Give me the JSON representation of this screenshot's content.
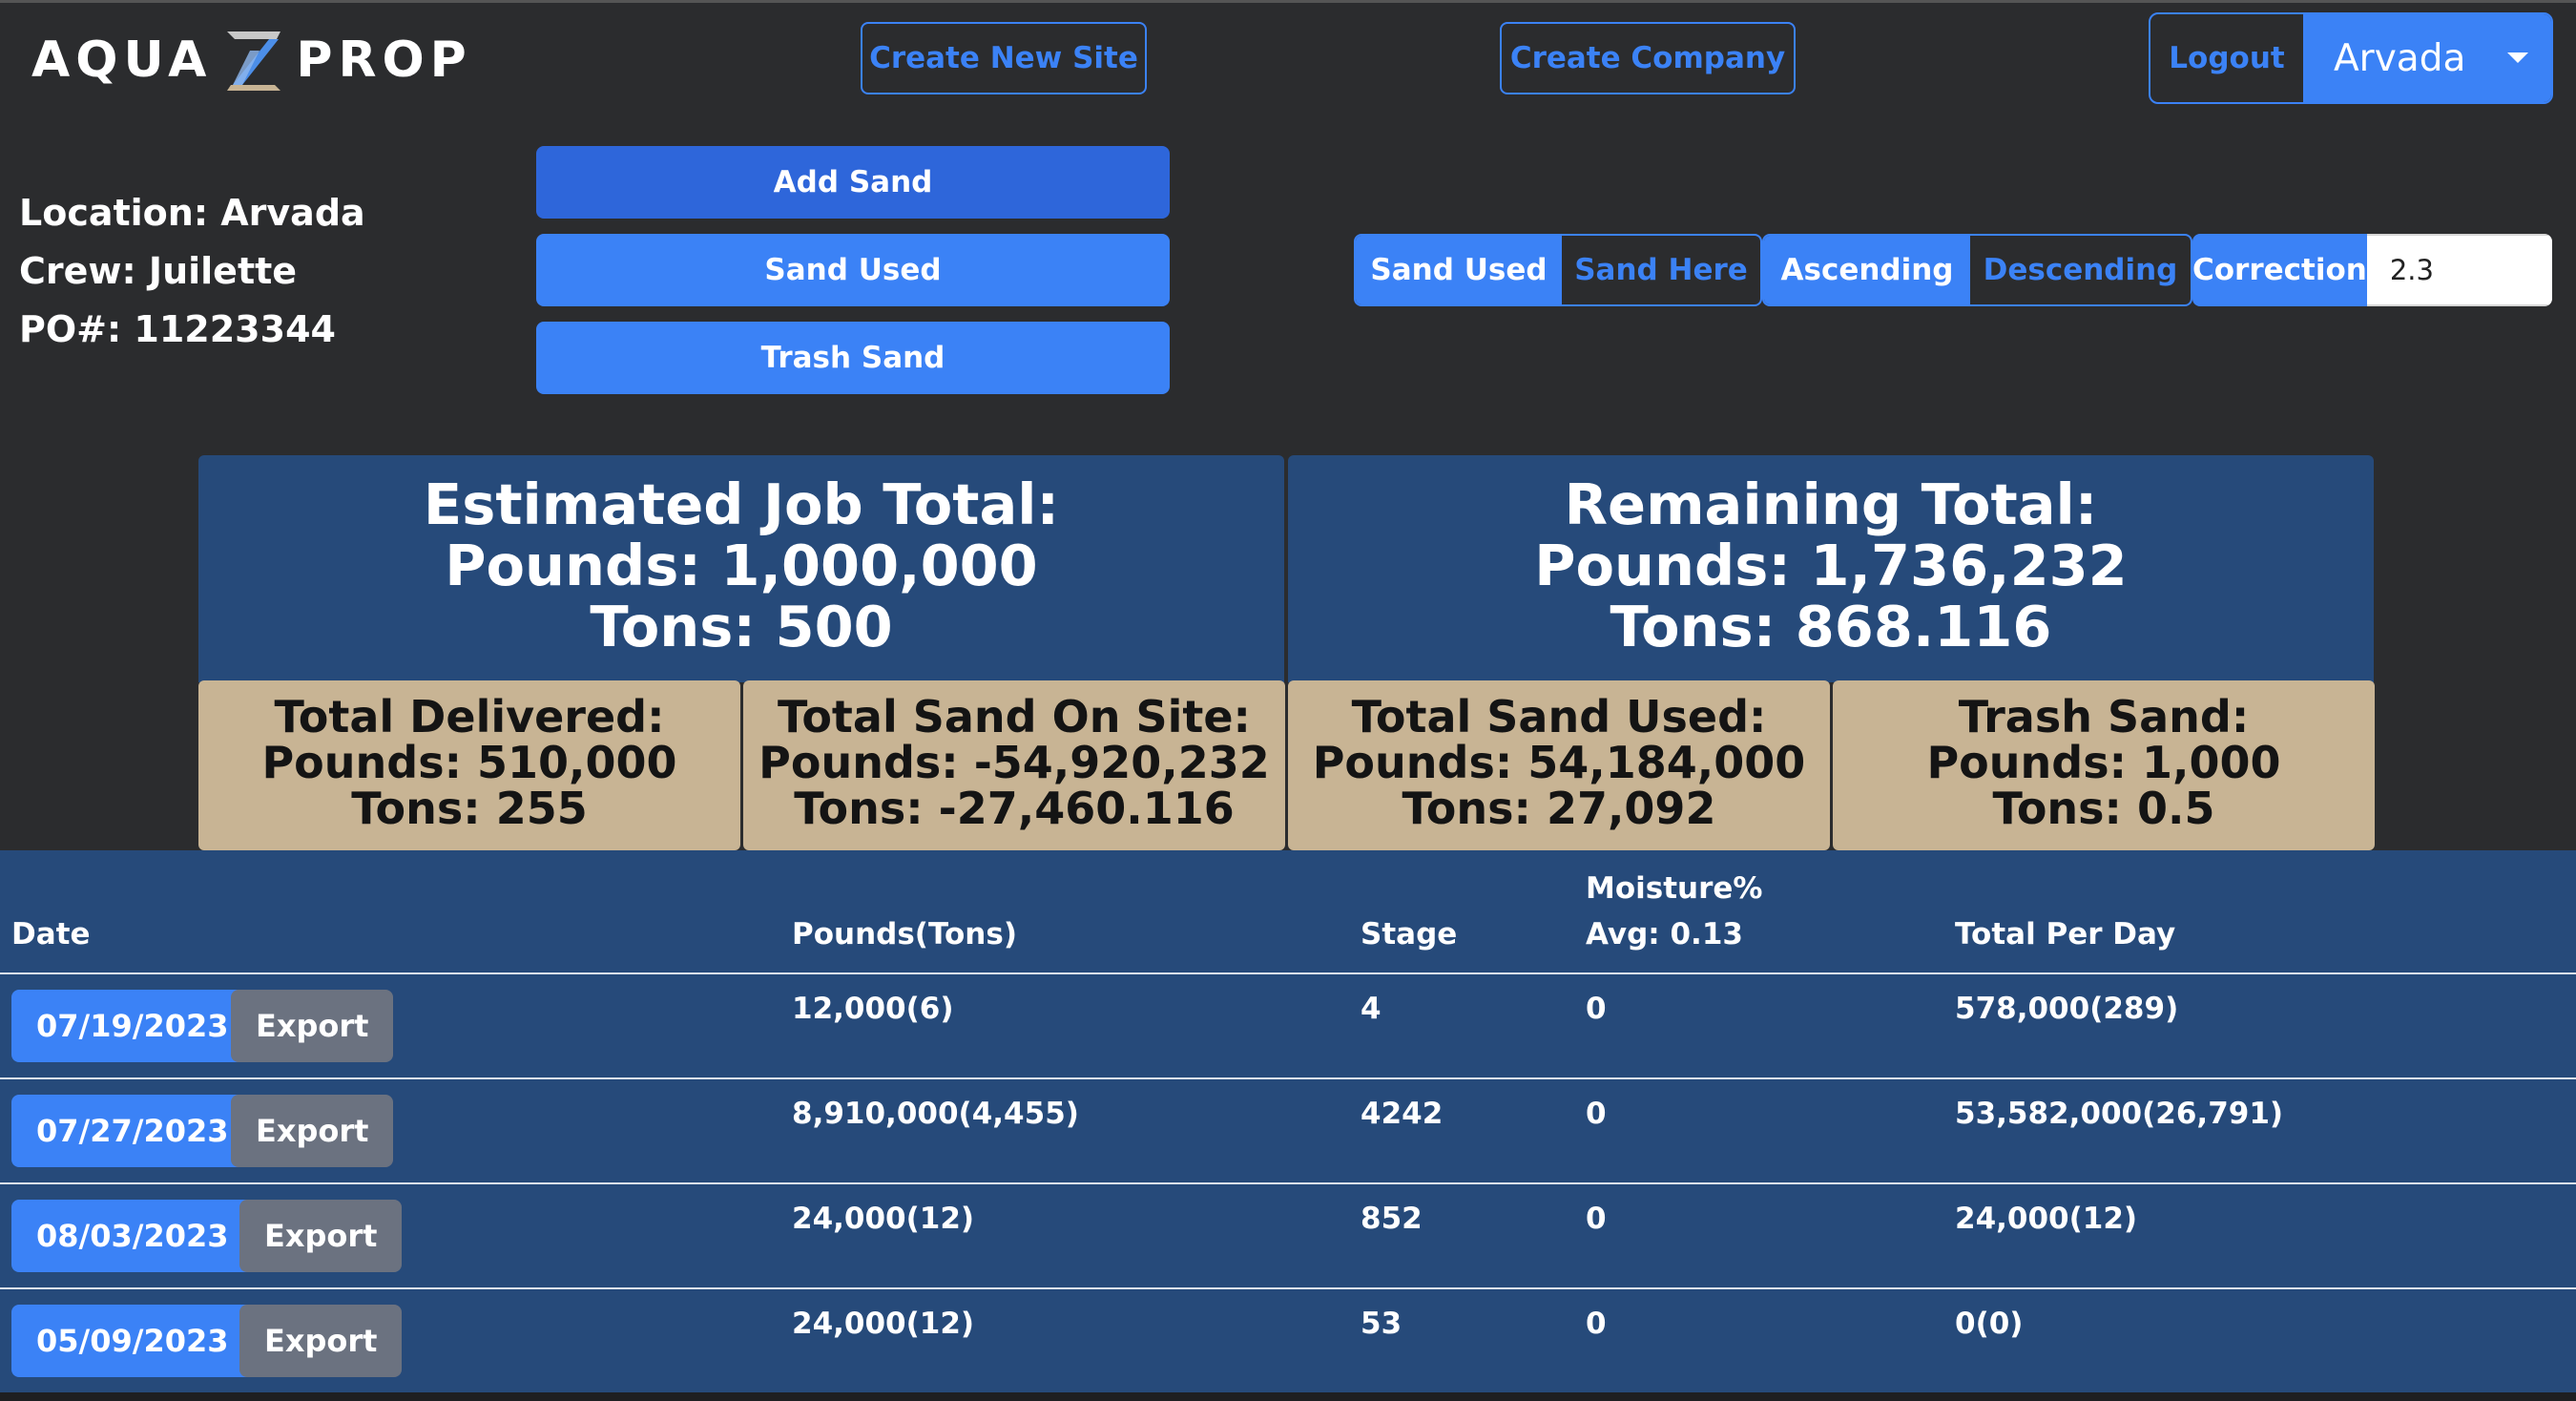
{
  "header": {
    "logo_left": "AQUA",
    "logo_right": "PROP",
    "create_site_label": "Create New Site",
    "create_company_label": "Create Company",
    "logout_label": "Logout",
    "selected_site": "Arvada"
  },
  "info": {
    "location": "Location: Arvada",
    "crew": "Crew: Juilette",
    "po": "PO#: 11223344"
  },
  "actions": {
    "add_sand": "Add Sand",
    "sand_used": "Sand Used",
    "trash_sand": "Trash Sand"
  },
  "toggles": {
    "sort_field": [
      "Sand Used",
      "Sand Here"
    ],
    "sort_order": [
      "Ascending",
      "Descending"
    ],
    "correction_label": "Correction",
    "correction_value": "2.3"
  },
  "summary": {
    "estimated": {
      "title": "Estimated Job Total:",
      "pounds": "Pounds: 1,000,000",
      "tons": "Tons: 500"
    },
    "remaining": {
      "title": "Remaining Total:",
      "pounds": "Pounds: 1,736,232",
      "tons": "Tons: 868.116"
    },
    "delivered": {
      "title": "Total Delivered:",
      "pounds": "Pounds: 510,000",
      "tons": "Tons: 255"
    },
    "onsite": {
      "title": "Total Sand On Site:",
      "pounds": "Pounds: -54,920,232",
      "tons": "Tons: -27,460.116"
    },
    "used": {
      "title": "Total Sand Used:",
      "pounds": "Pounds: 54,184,000",
      "tons": "Tons: 27,092"
    },
    "trash": {
      "title": "Trash Sand:",
      "pounds": "Pounds: 1,000",
      "tons": "Tons: 0.5"
    }
  },
  "table": {
    "headers": {
      "date": "Date",
      "pounds": "Pounds(Tons)",
      "stage": "Stage",
      "moisture": "Moisture%",
      "moisture_avg": "Avg: 0.13",
      "total": "Total Per Day"
    },
    "export_label": "Export",
    "rows": [
      {
        "date": "07/19/2023",
        "pounds": "12,000(6)",
        "stage": "4",
        "moisture": "0",
        "total": "578,000(289)"
      },
      {
        "date": "07/27/2023",
        "pounds": "8,910,000(4,455)",
        "stage": "4242",
        "moisture": "0",
        "total": "53,582,000(26,791)"
      },
      {
        "date": "08/03/2023",
        "pounds": "24,000(12)",
        "stage": "852",
        "moisture": "0",
        "total": "24,000(12)"
      },
      {
        "date": "05/09/2023",
        "pounds": "24,000(12)",
        "stage": "53",
        "moisture": "0",
        "total": "0(0)"
      }
    ]
  },
  "colors": {
    "background": "#2b2c2e",
    "accent": "#3b82f6",
    "panel_blue": "#264a7a",
    "panel_tan": "#c8b494",
    "export_gray": "#6b7280"
  }
}
